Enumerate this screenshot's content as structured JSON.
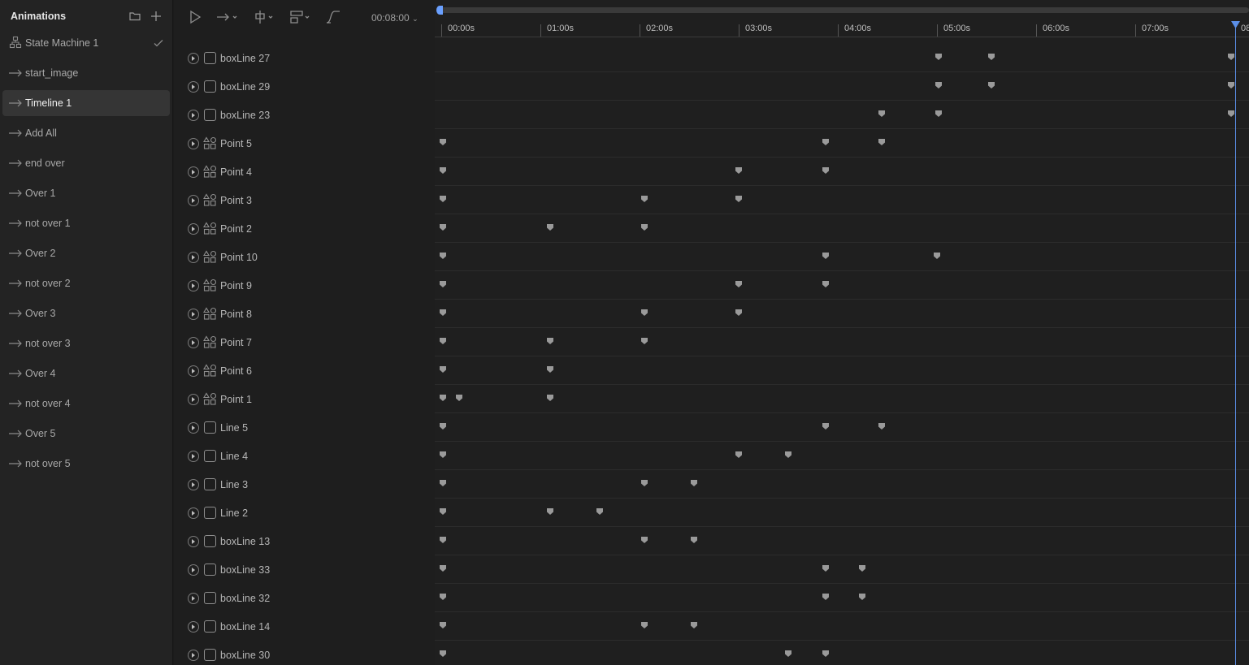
{
  "animations_panel": {
    "title": "Animations",
    "items": [
      {
        "label": "State Machine 1",
        "kind": "state-machine"
      },
      {
        "label": "start_image",
        "kind": "timeline"
      },
      {
        "label": "Timeline 1",
        "kind": "timeline",
        "selected": true
      },
      {
        "label": "Add All",
        "kind": "timeline"
      },
      {
        "label": "end over",
        "kind": "timeline"
      },
      {
        "label": "Over 1",
        "kind": "timeline"
      },
      {
        "label": "not over 1",
        "kind": "timeline"
      },
      {
        "label": "Over 2",
        "kind": "timeline"
      },
      {
        "label": "not over 2",
        "kind": "timeline"
      },
      {
        "label": "Over 3",
        "kind": "timeline"
      },
      {
        "label": "not over 3",
        "kind": "timeline"
      },
      {
        "label": "Over 4",
        "kind": "timeline"
      },
      {
        "label": "not over 4",
        "kind": "timeline"
      },
      {
        "label": "Over 5",
        "kind": "timeline"
      },
      {
        "label": "not over 5",
        "kind": "timeline"
      }
    ]
  },
  "toolbar": {
    "time_readout": "00:08:00",
    "icons": [
      "play-icon",
      "loop-mode-icon",
      "snap-icon",
      "view-options-icon",
      "easing-icon"
    ]
  },
  "timeline": {
    "duration_seconds": 8,
    "ruler_labels": [
      "00:00s",
      "01:00s",
      "02:00s",
      "03:00s",
      "04:00s",
      "05:00s",
      "06:00s",
      "07:00s"
    ],
    "playhead_label": "08",
    "playhead_seconds": 8,
    "accent_color": "#5b8fe8",
    "keyframe_color": "#9a9a9a"
  },
  "layers": [
    {
      "name": "boxLine 27",
      "type": "box",
      "keys": [
        5.0,
        5.53,
        8.0
      ]
    },
    {
      "name": "boxLine 29",
      "type": "box",
      "keys": [
        5.0,
        5.53,
        8.0
      ]
    },
    {
      "name": "boxLine 23",
      "type": "box",
      "keys": [
        4.43,
        5.0,
        8.0
      ]
    },
    {
      "name": "Point 5",
      "type": "shape",
      "keys": [
        0.0,
        3.86,
        4.43
      ]
    },
    {
      "name": "Point 4",
      "type": "shape",
      "keys": [
        0.0,
        2.98,
        3.86
      ]
    },
    {
      "name": "Point 3",
      "type": "shape",
      "keys": [
        0.0,
        2.03,
        2.98
      ]
    },
    {
      "name": "Point 2",
      "type": "shape",
      "keys": [
        0.0,
        1.08,
        2.03
      ]
    },
    {
      "name": "Point 10",
      "type": "shape",
      "keys": [
        0.0,
        3.86,
        4.98
      ]
    },
    {
      "name": "Point 9",
      "type": "shape",
      "keys": [
        0.0,
        2.98,
        3.86
      ]
    },
    {
      "name": "Point 8",
      "type": "shape",
      "keys": [
        0.0,
        2.03,
        2.98
      ]
    },
    {
      "name": "Point 7",
      "type": "shape",
      "keys": [
        0.0,
        1.08,
        2.03
      ]
    },
    {
      "name": "Point 6",
      "type": "shape",
      "keys": [
        0.0,
        1.08
      ]
    },
    {
      "name": "Point 1",
      "type": "shape",
      "keys": [
        0.0,
        0.16,
        1.08
      ]
    },
    {
      "name": "Line 5",
      "type": "box",
      "keys": [
        0.0,
        3.86,
        4.43
      ]
    },
    {
      "name": "Line 4",
      "type": "box",
      "keys": [
        0.0,
        2.98,
        3.48
      ]
    },
    {
      "name": "Line 3",
      "type": "box",
      "keys": [
        0.0,
        2.03,
        2.53
      ]
    },
    {
      "name": "Line 2",
      "type": "box",
      "keys": [
        0.0,
        1.08,
        1.58
      ]
    },
    {
      "name": "boxLine 13",
      "type": "box",
      "keys": [
        0.0,
        2.03,
        2.53
      ]
    },
    {
      "name": "boxLine 33",
      "type": "box",
      "keys": [
        0.0,
        3.86,
        4.23
      ]
    },
    {
      "name": "boxLine 32",
      "type": "box",
      "keys": [
        0.0,
        3.86,
        4.23
      ]
    },
    {
      "name": "boxLine 14",
      "type": "box",
      "keys": [
        0.0,
        2.03,
        2.53
      ]
    },
    {
      "name": "boxLine 30",
      "type": "box",
      "keys": [
        0.0,
        3.48,
        3.86
      ]
    }
  ]
}
